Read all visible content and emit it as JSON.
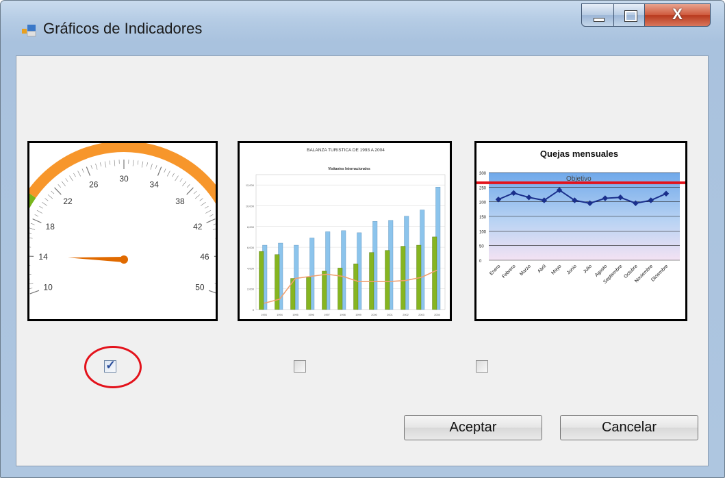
{
  "window": {
    "title": "Gráficos de Indicadores",
    "controls": {
      "minimize": "minimize",
      "maximize": "maximize",
      "close": "X"
    }
  },
  "gauge": {
    "tick_labels": [
      "10",
      "14",
      "18",
      "22",
      "26",
      "30",
      "34",
      "38",
      "42",
      "46",
      "50"
    ],
    "needle_value": 14,
    "range": [
      10,
      50
    ],
    "colors": {
      "green_band": "#7ab51d",
      "orange_band": "#f7962b",
      "needle": "#e06a00"
    }
  },
  "bar_chart": {
    "title": "BALANZA TURISTICA DE 1993 A 2004",
    "subtitle": "Visitantes Internacionales",
    "chart_data": {
      "type": "bar",
      "categories": [
        "1993",
        "1994",
        "1995",
        "1996",
        "1997",
        "1998",
        "1999",
        "2000",
        "2001",
        "2002",
        "2003",
        "2004"
      ],
      "yticks": [
        "0",
        "2,000",
        "4,000",
        "6,000",
        "8,000",
        "10,000",
        "12,000"
      ],
      "ylim": [
        0,
        13000
      ],
      "series": [
        {
          "values": [
            6200,
            6400,
            6200,
            6900,
            7500,
            7600,
            7400,
            8500,
            8600,
            9000,
            9600,
            11800
          ],
          "color": "#8cc4ec"
        },
        {
          "values": [
            5600,
            5300,
            3000,
            3100,
            3700,
            4000,
            4400,
            5500,
            5700,
            6100,
            6200,
            7000
          ],
          "color": "#86b521"
        },
        {
          "values": [
            600,
            1000,
            3000,
            3200,
            3400,
            3200,
            2700,
            2700,
            2700,
            2800,
            3100,
            3800
          ],
          "color": "#f0a070"
        }
      ]
    }
  },
  "line_chart": {
    "title": "Quejas mensuales",
    "objective_label": "Objetivo",
    "chart_data": {
      "type": "line",
      "categories": [
        "Enero",
        "Febrero",
        "Marzo",
        "Abril",
        "Mayo",
        "Junio",
        "Julio",
        "Agosto",
        "Septiembre",
        "Octubre",
        "Noviembre",
        "Diciembre"
      ],
      "values": [
        208,
        230,
        215,
        205,
        240,
        205,
        195,
        212,
        215,
        195,
        205,
        228
      ],
      "objective": 265,
      "yticks": [
        "0",
        "50",
        "100",
        "150",
        "200",
        "250",
        "300"
      ],
      "ylim": [
        0,
        300
      ],
      "colors": {
        "line": "#1a2f8c",
        "objective": "#e3121b"
      }
    }
  },
  "checkboxes": [
    {
      "checked": true
    },
    {
      "checked": false
    },
    {
      "checked": false
    }
  ],
  "buttons": {
    "accept": "Aceptar",
    "cancel": "Cancelar"
  }
}
